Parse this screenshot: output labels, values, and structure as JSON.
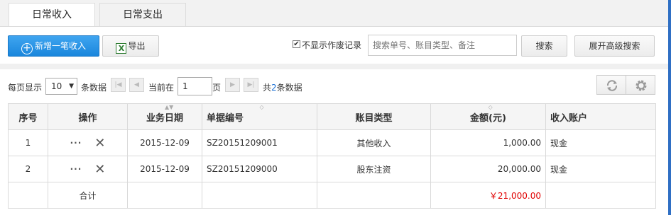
{
  "tabs": [
    {
      "label": "日常收入",
      "active": true
    },
    {
      "label": "日常支出",
      "active": false
    }
  ],
  "toolbar": {
    "add_label": "新增一笔收入",
    "export_label": "导出",
    "hide_void_label": "不显示作废记录",
    "hide_void_checked": "✔",
    "search_placeholder": "搜索单号、账目类型、备注",
    "search_label": "搜索",
    "advanced_label": "展开高级搜索"
  },
  "pager": {
    "per_page_label": "每页显示",
    "per_page_value": "10",
    "per_page_unit": "条数据",
    "current_label": "当前在",
    "current_page": "1",
    "page_unit": "页",
    "total_prefix": "共",
    "total_count": "2",
    "total_suffix": "条数据"
  },
  "table": {
    "headers": [
      "序号",
      "操作",
      "业务日期",
      "单据编号",
      "账目类型",
      "金额(元)",
      "收入账户"
    ],
    "rows": [
      {
        "no": "1",
        "date": "2015-12-09",
        "doc": "SZ20151209001",
        "type": "其他收入",
        "amount": "1,000.00",
        "account": "现金"
      },
      {
        "no": "2",
        "date": "2015-12-09",
        "doc": "SZ20151209000",
        "type": "股东注资",
        "amount": "20,000.00",
        "account": "现金"
      }
    ],
    "row_action_more": "···",
    "row_action_delete": "✕",
    "total_label": "合计",
    "total_amount": "￥21,000.00"
  },
  "colors": {
    "primary": "#1a86dc",
    "total": "#e00000",
    "link": "#1a6fd4"
  }
}
